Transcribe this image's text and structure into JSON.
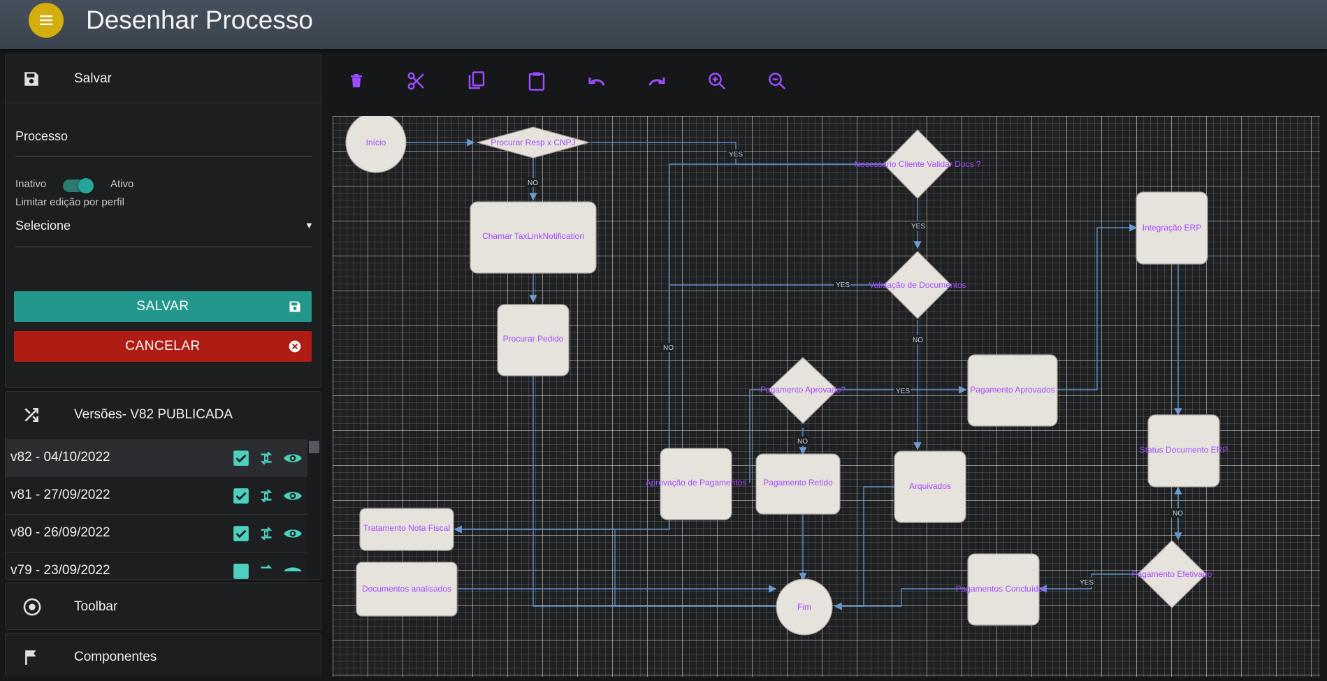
{
  "header": {
    "title": "Desenhar Processo",
    "menu_icon": "menu-icon"
  },
  "colors": {
    "accent": "#26a69a",
    "danger": "#b71c1c",
    "menu": "#d4ad0e",
    "node_text": "#a64dff",
    "edge": "#5b8fc9"
  },
  "form_panel": {
    "save_header": "Salvar",
    "process_label": "Processo",
    "toggle_off_label": "Inativo",
    "toggle_on_label": "Ativo",
    "limit_label": "Limitar edição por perfil",
    "select_value": "Selecione",
    "save_button": "SALVAR",
    "cancel_button": "CANCELAR"
  },
  "versions": {
    "header": "Versões- V82 PUBLICADA",
    "items": [
      {
        "label": "v82 - 04/10/2022"
      },
      {
        "label": "v81 - 27/09/2022"
      },
      {
        "label": "v80 - 26/09/2022"
      },
      {
        "label": "v79 - 23/09/2022"
      }
    ]
  },
  "toolbar_panel": {
    "label": "Toolbar"
  },
  "components_panel": {
    "label": "Componentes"
  },
  "tools": [
    "delete-icon",
    "cut-icon",
    "copy-icon",
    "paste-icon",
    "undo-icon",
    "redo-icon",
    "zoom-in-icon",
    "zoom-out-icon"
  ],
  "diagram": {
    "nodes": {
      "inicio": "Início",
      "procurar_resp": "Procurar Resp x CNPJ",
      "necessario": "Necessário Cliente Validar Docs ?",
      "chamar": "Chamar TaxLinkNotification",
      "integracao": "Integração ERP",
      "validacao": "Validação de Documentos",
      "procurar_pedido": "Procurar Pedido",
      "pag_aprovado_q": "Pagamento Aprovado?",
      "pag_aprovados": "Pagamento Aprovados",
      "status_doc": "Status Documento ERP",
      "aprovacao": "Aprovação de Pagamentos",
      "pag_retido": "Pagamento Retido",
      "arquivados": "Arquivados",
      "tratamento": "Tratamento Nota Fiscal",
      "pag_efetivado": "Pagamento Efetivado",
      "doc_analisados": "Documentos analisados",
      "fim": "Fim",
      "pag_concluidos": "Pagamentos Concluídos"
    },
    "edge_labels": {
      "yes": "YES",
      "no": "NO"
    }
  }
}
